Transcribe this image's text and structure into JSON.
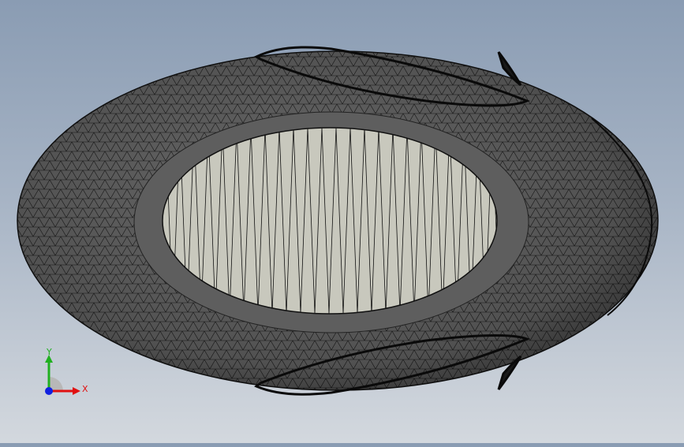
{
  "viewport": {
    "model": "mesh-torus",
    "colors": {
      "background_top": "#8a9cb3",
      "background_bottom": "#d3d8de",
      "mesh_fill": "#707070",
      "mesh_line": "#111111",
      "inner_face": "#c9c9be"
    }
  },
  "triad": {
    "x_label": "X",
    "y_label": "Y",
    "x_color": "#e01010",
    "y_color": "#20b020",
    "z_color": "#1020e0"
  }
}
